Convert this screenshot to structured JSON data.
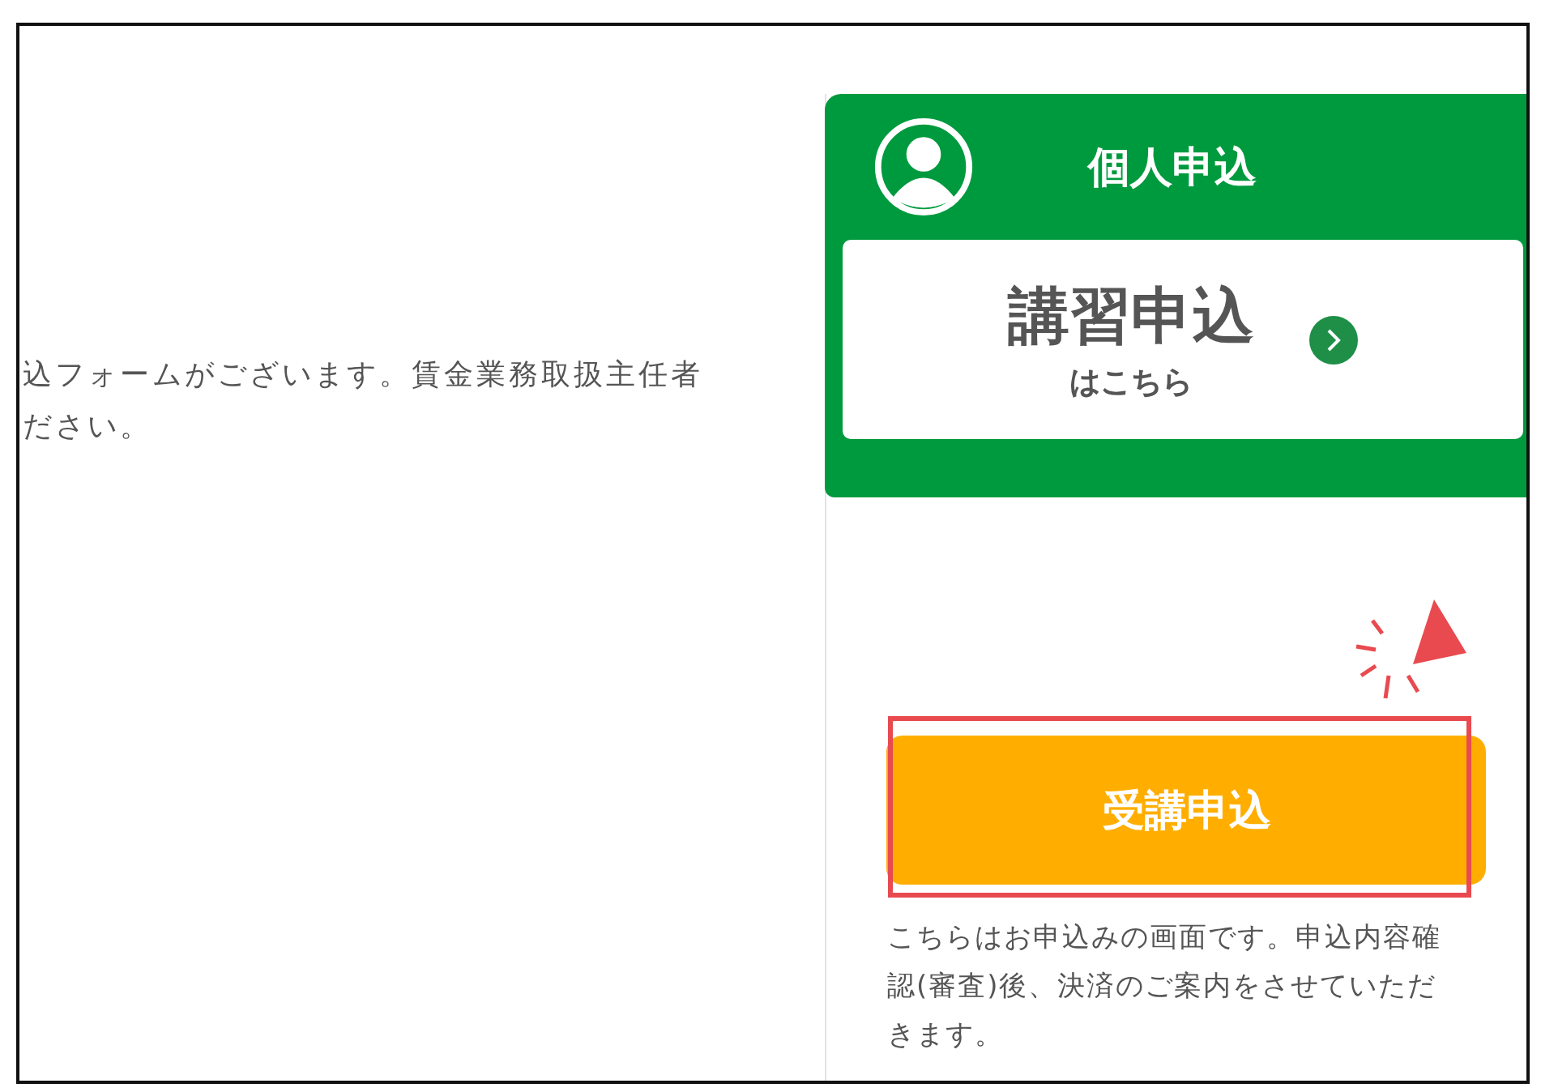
{
  "intro_lines": [
    "込フォームがございます。賃金業務取扱主任者",
    "ださい。"
  ],
  "individual_card": {
    "title": "個人申込",
    "link": {
      "title": "講習申込",
      "subtitle": "はこちら"
    }
  },
  "apply_button": {
    "label": "受講申込",
    "highlighted": true
  },
  "note": "こちらはお申込みの画面です。申込内容確認(審査)後、決済のご案内をさせていただきます。"
}
